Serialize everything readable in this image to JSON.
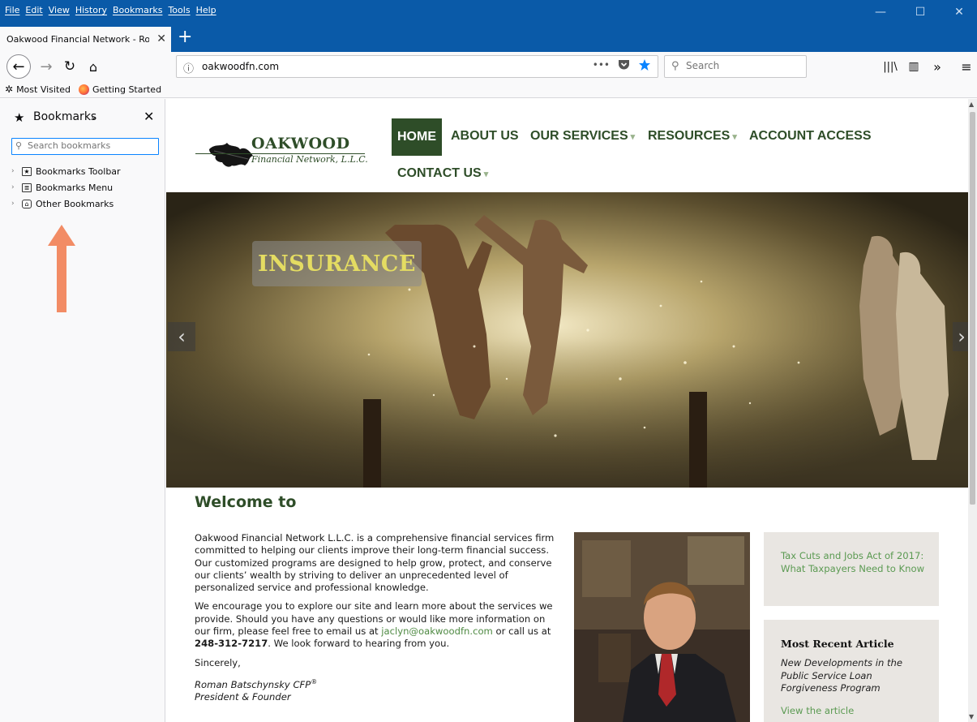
{
  "menubar": {
    "items": [
      "File",
      "Edit",
      "View",
      "History",
      "Bookmarks",
      "Tools",
      "Help"
    ],
    "controls": {
      "minimize": "—",
      "maximize": "☐",
      "close": "✕"
    }
  },
  "tab": {
    "title": "Oakwood Financial Network - Rom",
    "close": "✕",
    "new_tab": "+"
  },
  "navbar": {
    "back": "←",
    "forward": "→",
    "reload": "↻",
    "home": "⌂",
    "url": "oakwoodfn.com",
    "page_actions": "•••",
    "search_placeholder": "Search",
    "library": "|||\\",
    "sidebar_toggle": "▥",
    "overflow": "»",
    "menu": "≡"
  },
  "bookmarks_toolbar": {
    "items": [
      "Most Visited",
      "Getting Started"
    ]
  },
  "sidebar": {
    "title": "Bookmarks",
    "close": "✕",
    "search_placeholder": "Search bookmarks",
    "tree": [
      "Bookmarks Toolbar",
      "Bookmarks Menu",
      "Other Bookmarks"
    ]
  },
  "site": {
    "logo": {
      "name": "OAKWOOD",
      "subtitle": "Financial Network, L.L.C."
    },
    "nav": {
      "home": "HOME",
      "about": "ABOUT US",
      "services": "OUR SERVICES",
      "resources": "RESOURCES",
      "account": "ACCOUNT ACCESS",
      "contact": "CONTACT US",
      "caret": "▾"
    },
    "hero": {
      "caption": "INSURANCE",
      "prev": "‹",
      "next": "›"
    },
    "welcome": "Welcome to",
    "body": {
      "p1": "Oakwood Financial Network L.L.C. is a comprehensive financial services firm committed to helping our clients improve their long-term financial success. Our customized programs are designed to help grow, protect, and conserve our clients’ wealth by striving to deliver an unprecedented level of personalized service and professional knowledge.",
      "p2_start": "We encourage you to explore our site and learn more about the services we provide. Should you have any questions or would like more information on our firm, please feel free to email us at ",
      "email": "jaclyn@oakwoodfn.com",
      "p2_mid": " or call us at ",
      "phone": "248-312-7217",
      "p2_end": ". We look forward to hearing from you.",
      "closing": "Sincerely,",
      "signature_name": "Roman Batschynsky CFP",
      "signature_mark": "®",
      "signature_title": "President & Founder"
    },
    "aside": {
      "tax_link": "Tax Cuts and Jobs Act of 2017: What Taxpayers Need to Know",
      "recent_heading": "Most Recent Article",
      "recent_title": "New Developments in the Public Service Loan Forgiveness Program",
      "recent_link": "View the article"
    }
  },
  "colors": {
    "titlebar": "#0a5aa8",
    "brand_green": "#2e4d28",
    "link_green": "#5b9a52",
    "annotation_arrow": "#f28c65"
  }
}
